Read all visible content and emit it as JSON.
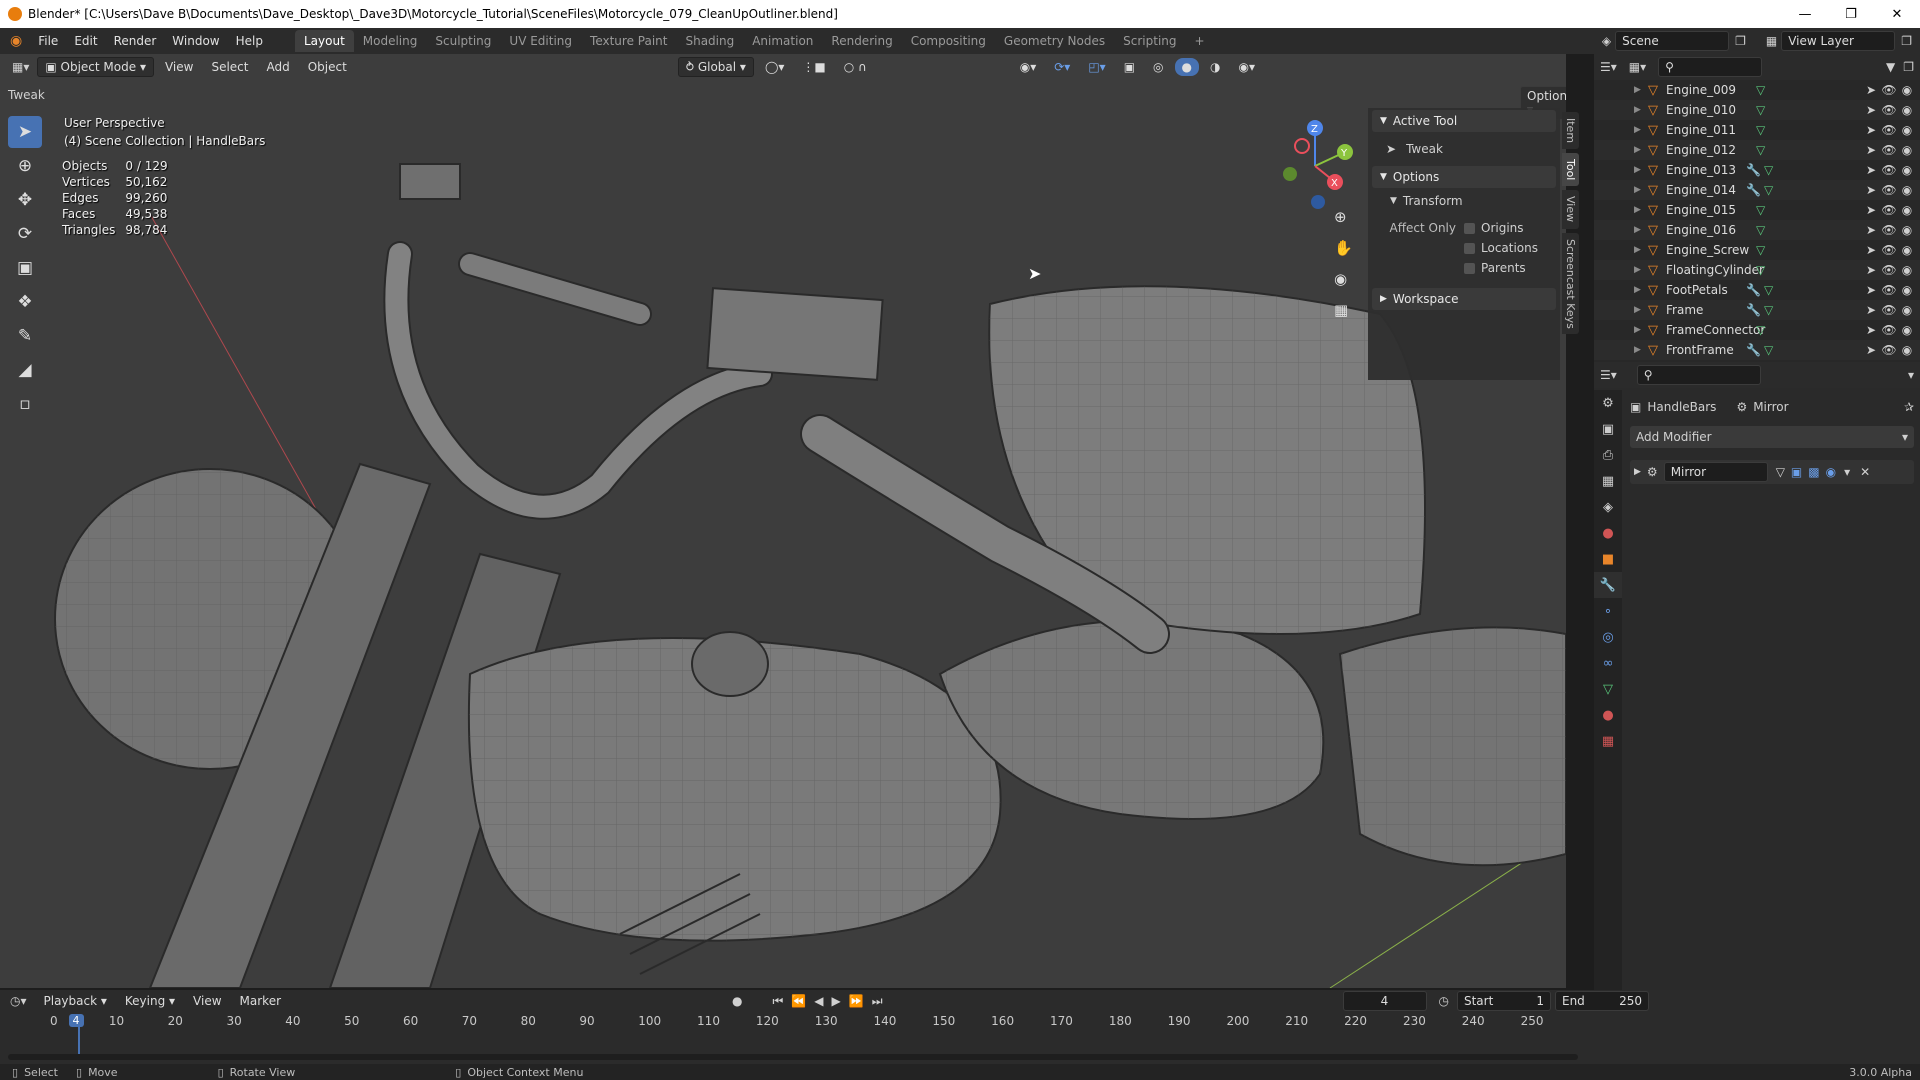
{
  "window": {
    "title": "Blender* [C:\\Users\\Dave B\\Documents\\Dave_Desktop\\_Dave3D\\Motorcycle_Tutorial\\SceneFiles\\Motorcycle_079_CleanUpOutliner.blend]"
  },
  "menu": [
    "File",
    "Edit",
    "Render",
    "Window",
    "Help"
  ],
  "workspaces": [
    "Layout",
    "Modeling",
    "Sculpting",
    "UV Editing",
    "Texture Paint",
    "Shading",
    "Animation",
    "Rendering",
    "Compositing",
    "Geometry Nodes",
    "Scripting",
    "+"
  ],
  "scene": {
    "label": "Scene",
    "view_layer": "View Layer"
  },
  "viewport": {
    "mode": "Object Mode",
    "menus": [
      "View",
      "Select",
      "Add",
      "Object"
    ],
    "orientation": "Global",
    "tool_name": "Tweak",
    "options": "Options",
    "perspective": "User Perspective",
    "collection": "(4) Scene Collection | HandleBars",
    "stats": [
      {
        "label": "Objects",
        "value": "0 / 129"
      },
      {
        "label": "Vertices",
        "value": "50,162"
      },
      {
        "label": "Edges",
        "value": "99,260"
      },
      {
        "label": "Faces",
        "value": "49,538"
      },
      {
        "label": "Triangles",
        "value": "98,784"
      }
    ],
    "axes": {
      "x": "X",
      "y": "Y",
      "z": "Z"
    }
  },
  "npanel": {
    "active_tool": "Active Tool",
    "tool": "Tweak",
    "options": "Options",
    "transform": "Transform",
    "affect_only": "Affect Only",
    "origins": "Origins",
    "locations": "Locations",
    "parents": "Parents",
    "workspace": "Workspace",
    "tabs": [
      "Item",
      "Tool",
      "View",
      "Screencast Keys"
    ]
  },
  "outliner": {
    "items": [
      {
        "name": "Engine_009",
        "mod": false
      },
      {
        "name": "Engine_010",
        "mod": false
      },
      {
        "name": "Engine_011",
        "mod": false
      },
      {
        "name": "Engine_012",
        "mod": false
      },
      {
        "name": "Engine_013",
        "mod": true
      },
      {
        "name": "Engine_014",
        "mod": true
      },
      {
        "name": "Engine_015",
        "mod": false
      },
      {
        "name": "Engine_016",
        "mod": false
      },
      {
        "name": "Engine_Screw",
        "mod": false
      },
      {
        "name": "FloatingCylinder",
        "mod": false
      },
      {
        "name": "FootPetals",
        "mod": true
      },
      {
        "name": "Frame",
        "mod": true
      },
      {
        "name": "FrameConnector",
        "mod": false
      },
      {
        "name": "FrontFrame",
        "mod": true
      }
    ]
  },
  "properties": {
    "object": "HandleBars",
    "modifier_crumb": "Mirror",
    "add_modifier": "Add Modifier",
    "modifier_name": "Mirror"
  },
  "timeline": {
    "menus": [
      "Playback",
      "Keying",
      "View",
      "Marker"
    ],
    "current_frame": "4",
    "start_label": "Start",
    "start": "1",
    "end_label": "End",
    "end": "250",
    "ticks": [
      "0",
      "10",
      "20",
      "30",
      "40",
      "50",
      "60",
      "70",
      "80",
      "90",
      "100",
      "110",
      "120",
      "130",
      "140",
      "150",
      "160",
      "170",
      "180",
      "190",
      "200",
      "210",
      "220",
      "230",
      "240",
      "250"
    ]
  },
  "statusbar": {
    "select": "Select",
    "move": "Move",
    "rotate": "Rotate View",
    "context": "Object Context Menu",
    "version": "3.0.0 Alpha"
  }
}
